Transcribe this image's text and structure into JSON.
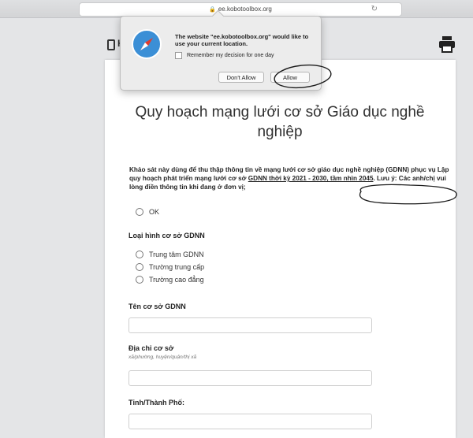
{
  "browser": {
    "url": "ee.kobotoolbox.org"
  },
  "header": {
    "app_letter": "K"
  },
  "form": {
    "title": "Quy hoạch mạng lưới cơ sở Giáo dục nghề nghiệp",
    "intro_part1": "Khảo sát này dùng để thu thập thông tin về mạng lưới cơ sở giáo dục nghề nghiệp (GDNN) phục vụ Lập quy hoạch phát triển mạng lưới cơ sở ",
    "intro_underlined": "GDNN thời kỳ 2021 - 2030, tầm nhìn 2045",
    "intro_part2": ". Lưu ý: Các anh/chị vui lòng điền thông tin khi đang ở đơn vị;",
    "ok_option": "OK",
    "q_type_label": "Loại hình cơ sở GDNN",
    "type_options": [
      "Trung tâm GDNN",
      "Trường trung cấp",
      "Trường cao đẳng"
    ],
    "q_name_label": "Tên cơ sở GDNN",
    "q_address_label": "Địa chỉ cơ sở",
    "q_address_hint": "xã/phường, huyện/quận/thị xã",
    "q_province_label": "Tỉnh/Thành Phố:"
  },
  "popover": {
    "message": "The website \"ee.kobotoolbox.org\" would like to use your current location.",
    "remember_label": "Remember my decision for one day",
    "dont_allow_label": "Don't Allow",
    "allow_label": "Allow"
  }
}
